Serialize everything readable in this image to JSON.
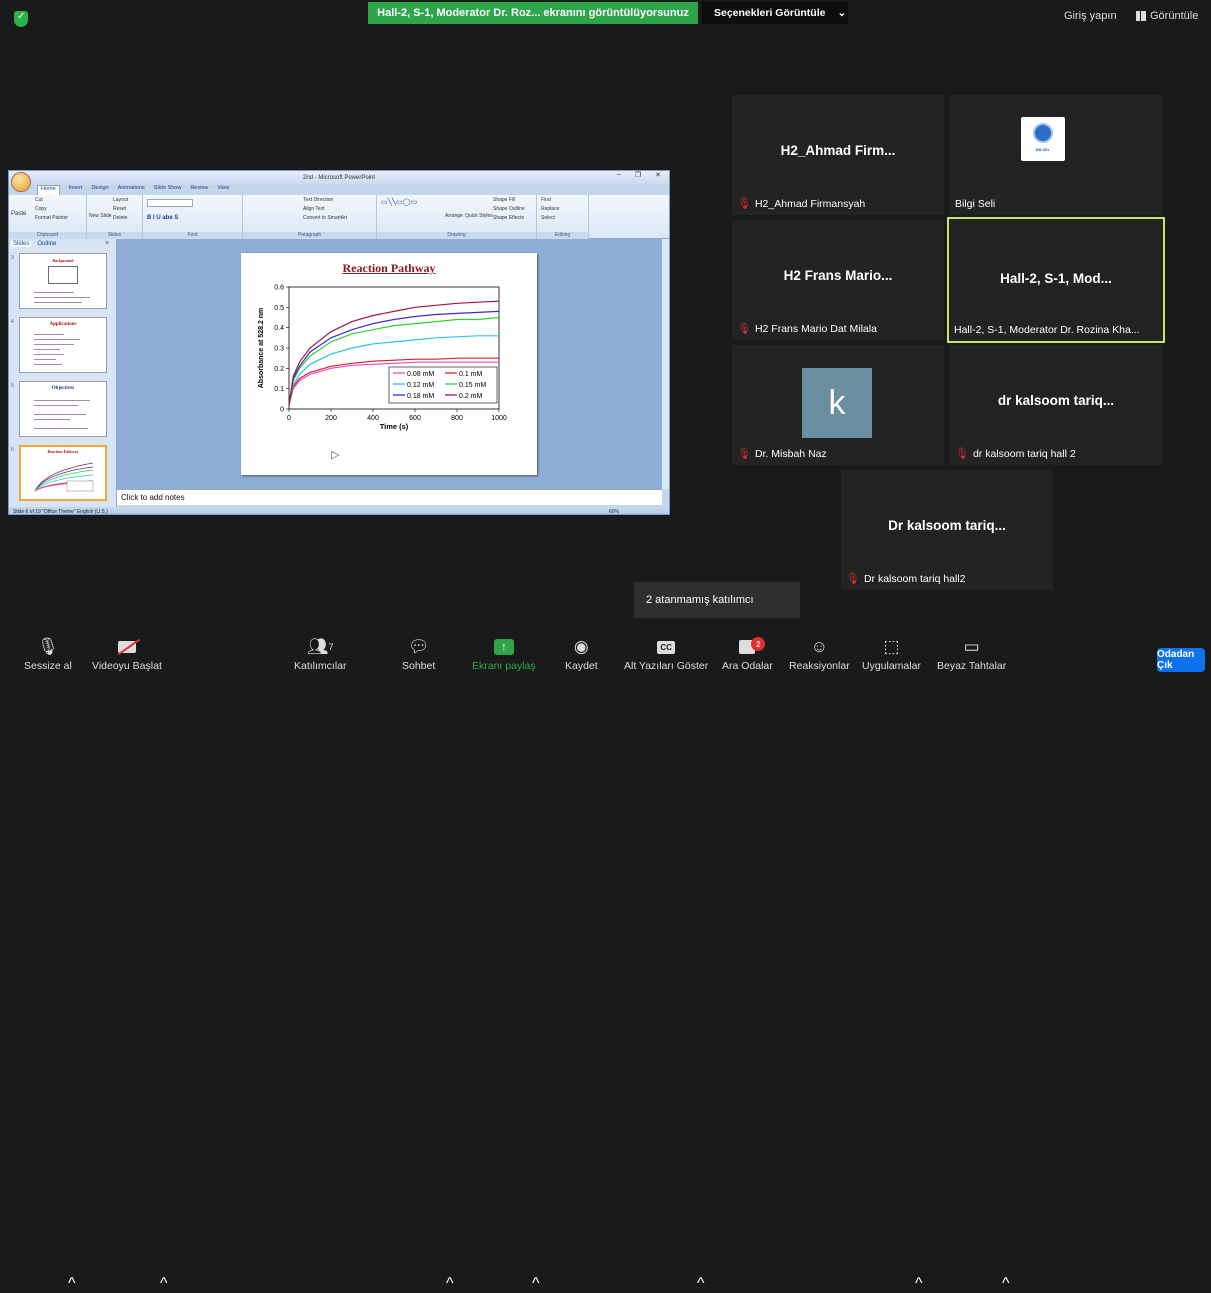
{
  "top": {
    "share_banner": "Hall-2, S-1, Moderator Dr. Roz... ekranını görüntülüyorsunuz",
    "view_options": "Seçenekleri Görüntüle",
    "view_options_caret": "⌄",
    "sign_in": "Giriş yapın",
    "view": "Görüntüle"
  },
  "ppt": {
    "window_title": "2nd - Microsoft PowerPoint",
    "tabs": [
      "Home",
      "Insert",
      "Design",
      "Animations",
      "Slide Show",
      "Review",
      "View"
    ],
    "ribbon_groups": [
      "Clipboard",
      "Slides",
      "Font",
      "Paragraph",
      "Drawing",
      "Editing"
    ],
    "ribbon_items": {
      "cut": "Cut",
      "copy": "Copy",
      "format_painter": "Format Painter",
      "paste": "Paste",
      "layout": "Layout",
      "reset": "Reset",
      "delete": "Delete",
      "new_slide": "New Slide",
      "text_direction": "Text Direction",
      "align_text": "Align Text",
      "smartart": "Convert to SmartArt",
      "arrange": "Arrange",
      "quick_styles": "Quick Styles",
      "shape_fill": "Shape Fill",
      "shape_outline": "Shape Outline",
      "shape_effects": "Shape Effects",
      "find": "Find",
      "replace": "Replace",
      "select": "Select"
    },
    "panel_tabs": [
      "Slides",
      "Outline"
    ],
    "panel_close": "×",
    "thumbnails": [
      {
        "num": "3",
        "title": "Background"
      },
      {
        "num": "4",
        "title": "Applications"
      },
      {
        "num": "5",
        "title": "Objectives"
      },
      {
        "num": "6",
        "title": "Reaction Pathway"
      }
    ],
    "notes_placeholder": "Click to add notes",
    "status": "Slide 6 of 19   \"Office Theme\"   English (U.S.)",
    "zoom": "60%"
  },
  "slide": {
    "title": "Reaction Pathway",
    "chart_data": {
      "type": "line",
      "xlabel": "Time (s)",
      "ylabel": "Absorbance  at 528.2 nm",
      "xlim": [
        0,
        1000
      ],
      "ylim": [
        0,
        0.6
      ],
      "xticks": [
        0,
        200,
        400,
        600,
        800,
        1000
      ],
      "yticks": [
        0,
        0.1,
        0.2,
        0.3,
        0.4,
        0.5,
        0.6
      ],
      "x": [
        0,
        20,
        50,
        100,
        200,
        300,
        400,
        500,
        600,
        700,
        800,
        900,
        1000
      ],
      "series": [
        {
          "name": "0.08 mM",
          "color": "#e24ad0",
          "values": [
            0.02,
            0.1,
            0.14,
            0.17,
            0.2,
            0.215,
            0.22,
            0.225,
            0.23,
            0.23,
            0.23,
            0.23,
            0.23
          ]
        },
        {
          "name": "0.1 mM",
          "color": "#d12424",
          "values": [
            0.02,
            0.11,
            0.15,
            0.18,
            0.21,
            0.225,
            0.235,
            0.24,
            0.245,
            0.245,
            0.25,
            0.25,
            0.25
          ]
        },
        {
          "name": "0.12 mM",
          "color": "#2cc4e8",
          "values": [
            0.02,
            0.12,
            0.17,
            0.22,
            0.27,
            0.3,
            0.32,
            0.33,
            0.34,
            0.35,
            0.355,
            0.36,
            0.36
          ]
        },
        {
          "name": "0.15 mM",
          "color": "#2fd12f",
          "values": [
            0.02,
            0.14,
            0.2,
            0.26,
            0.33,
            0.37,
            0.39,
            0.41,
            0.42,
            0.43,
            0.44,
            0.44,
            0.45
          ]
        },
        {
          "name": "0.18 mM",
          "color": "#3a2bd1",
          "values": [
            0.02,
            0.15,
            0.21,
            0.28,
            0.35,
            0.39,
            0.42,
            0.44,
            0.455,
            0.465,
            0.47,
            0.475,
            0.48
          ]
        },
        {
          "name": "0.2 mM",
          "color": "#a3163a",
          "values": [
            0.02,
            0.16,
            0.23,
            0.3,
            0.38,
            0.43,
            0.46,
            0.48,
            0.5,
            0.51,
            0.52,
            0.525,
            0.53
          ]
        }
      ],
      "legend_placement": "bottom-right"
    }
  },
  "tiles": [
    {
      "big": "H2_Ahmad  Firm...",
      "label": "H2_Ahmad Firmansyah",
      "muted": true
    },
    {
      "big": "",
      "label": "Bilgi Seli",
      "muted": false,
      "logo_text": "BİLSEL"
    },
    {
      "big": "H2  Frans  Mario...",
      "label": "H2 Frans Mario Dat Milala",
      "muted": true
    },
    {
      "big": "Hall-2,  S-1,  Mod...",
      "label": "Hall-2, S-1, Moderator Dr. Rozina Kha...",
      "muted": false
    },
    {
      "big": "",
      "label": "Dr. Misbah Naz",
      "muted": true,
      "avatar": "k"
    },
    {
      "big": "dr  kalsoom  tariq...",
      "label": "dr kalsoom tariq hall  2",
      "muted": true
    },
    {
      "big": "Dr  kalsoom  tariq...",
      "label": "Dr kalsoom tariq hall2",
      "muted": true
    }
  ],
  "tooltip": "2 atanmamış katılımcı",
  "toolbar": {
    "mute": "Sessize al",
    "video": "Videoyu Başlat",
    "participants": "Katılımcılar",
    "participants_count": "7",
    "chat": "Sohbet",
    "share": "Ekranı paylaş",
    "record": "Kaydet",
    "captions": "Alt Yazıları Göster",
    "captions_icon": "CC",
    "breakout": "Ara Odalar",
    "breakout_badge": "2",
    "reactions": "Reaksiyonlar",
    "apps": "Uygulamalar",
    "whiteboard": "Beyaz Tahtalar",
    "end": "Odadan Çık"
  },
  "colors": {
    "share_green": "#2ea54a",
    "end_blue": "#0e72ed",
    "active_border": "#c7e56c",
    "muted_red": "#e02d2d"
  }
}
